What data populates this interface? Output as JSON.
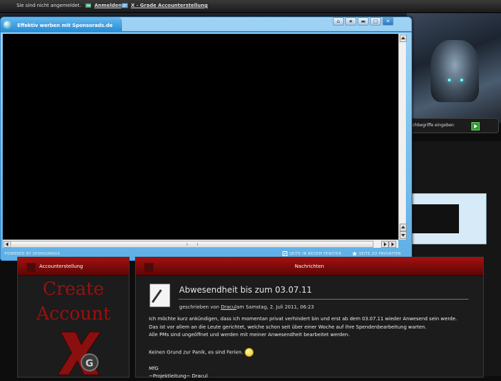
{
  "topbar": {
    "not_logged_in": "Sie sind nicht angemeldet.",
    "login_label": "Anmelden",
    "account_label": "X - Grade Accounterstellung"
  },
  "popup": {
    "title": "Effektiv werben mit Sponsorads.de",
    "powered_by": "POWERED BY SPONSORADS",
    "new_window_label": "SEITE IN NEUEM FENSTER",
    "favorites_label": "SEITE ZU FAVORITEN"
  },
  "search": {
    "label": "Suchbegriffe eingeben"
  },
  "left_box": {
    "header": "Accounterstellung",
    "create_line1": "Create",
    "create_line2": "Account"
  },
  "news_box": {
    "header": "Nachrichten",
    "post_title": "Abwesendheit bis zum 03.07.11",
    "meta_prefix": "geschrieben von",
    "meta_author": "Dracul",
    "meta_suffix": "am Samstag, 2. Juli 2011, 06:23",
    "body_line1": "Ich möchte kurz ankündigen, dass ich momentan privat verhindert bin und erst ab dem 03.07.11 wieder Anwesend sein werde.",
    "body_line2": "Das ist vor allem an die Leute gerichtet, welche schon seit über einer Woche auf ihre Spendenbearbeitung warten.",
    "body_line3": "Alle PMs sind ungeöffnet und werden mit meiner Anwesendheit bearbeitet werden.",
    "body_line4": "Keinen Grund zur Panik, es sind Ferien.",
    "body_line5": "MfG",
    "body_line6": "~Projektleitung~ Dracul"
  }
}
